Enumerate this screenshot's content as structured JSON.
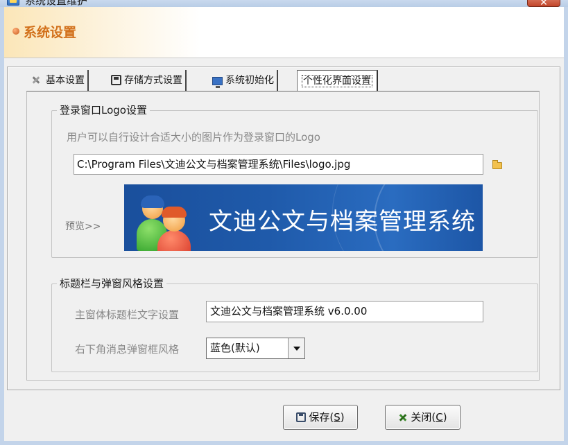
{
  "window": {
    "title": "系统设置维护",
    "close_glyph": "✕"
  },
  "header": {
    "title": "系统设置"
  },
  "tabs": [
    {
      "label": "基本设置",
      "icon": "wrench-icon"
    },
    {
      "label": "存储方式设置",
      "icon": "disk-icon"
    },
    {
      "label": "系统初始化",
      "icon": "monitor-icon"
    },
    {
      "label": "个性化界面设置",
      "active": true
    }
  ],
  "logo_group": {
    "legend": "登录窗口Logo设置",
    "hint": "用户可以自行设计合适大小的图片作为登录窗口的Logo",
    "path_value": "C:\\Program Files\\文迪公文与档案管理系统\\Files\\logo.jpg",
    "preview_label": "预览>>",
    "preview_text": "文迪公文与档案管理系统"
  },
  "title_group": {
    "legend": "标题栏与弹窗风格设置",
    "title_label": "主窗体标题栏文字设置",
    "title_value": "文迪公文与档案管理系统 v6.0.00",
    "popup_label": "右下角消息弹窗框风格",
    "popup_value": "蓝色(默认)"
  },
  "buttons": {
    "save_label": "保存(",
    "save_key": "S",
    "save_tail": ")",
    "close_label": "关闭(",
    "close_key": "C",
    "close_tail": ")"
  },
  "colors": {
    "accent": "#d2701a",
    "logo_bg": "#1f5aaa"
  }
}
